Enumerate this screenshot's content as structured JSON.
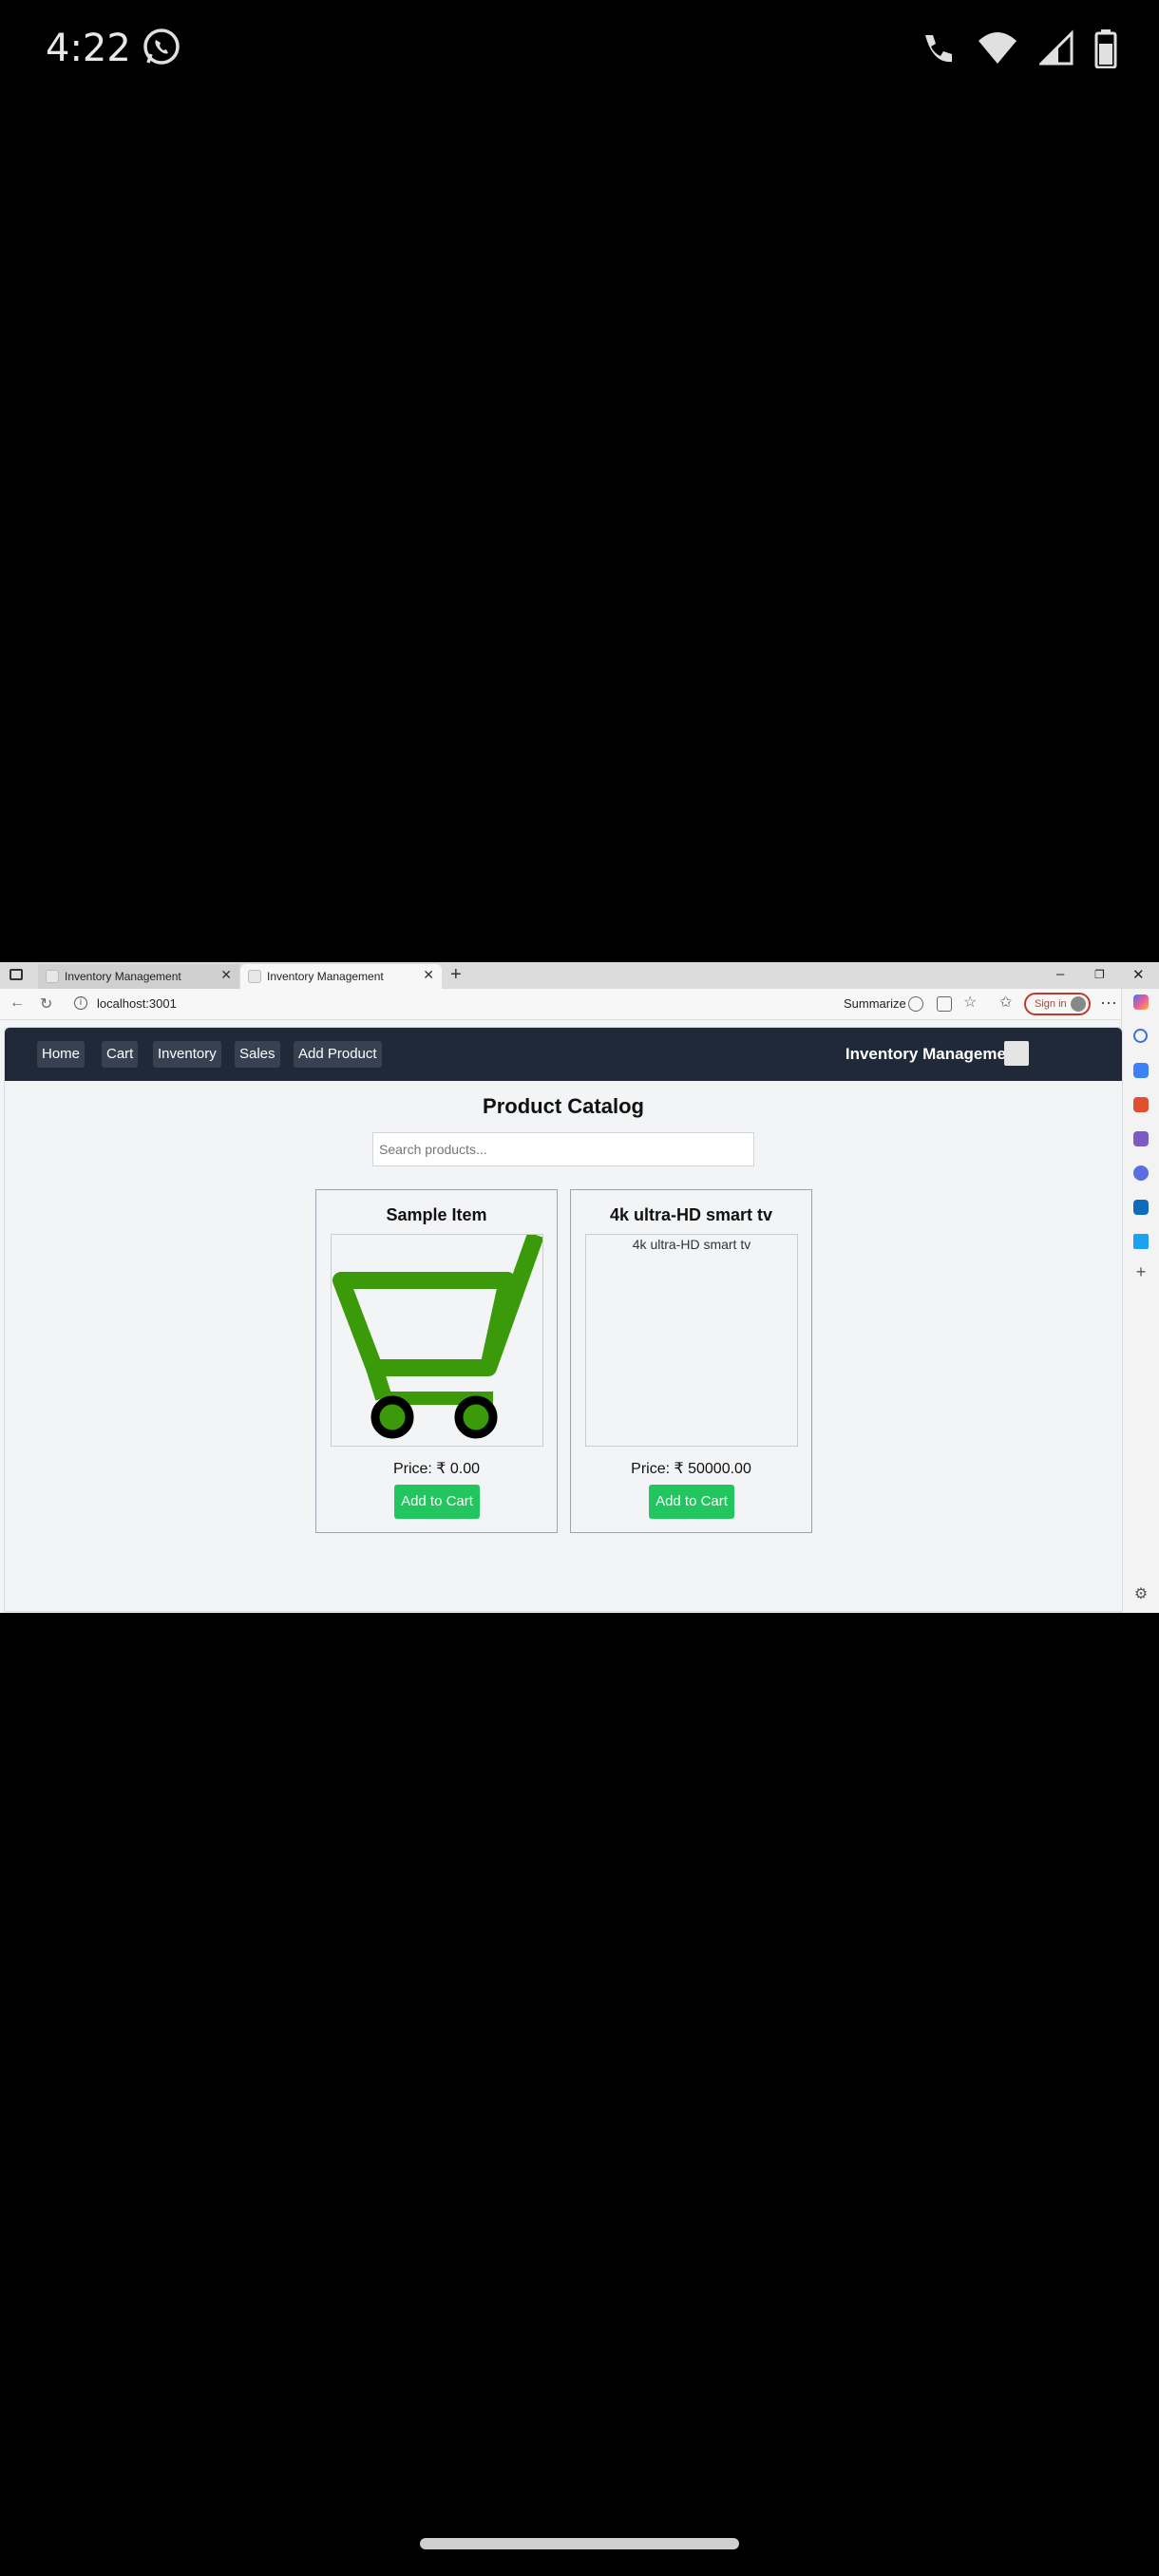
{
  "status_bar": {
    "time": "4:22"
  },
  "browser": {
    "tabs": [
      {
        "title": "Inventory Management"
      },
      {
        "title": "Inventory Management"
      }
    ],
    "url": "localhost:3001",
    "summarize_label": "Summarize",
    "signin_label": "Sign in"
  },
  "app": {
    "nav_items": [
      "Home",
      "Cart",
      "Inventory",
      "Sales",
      "Add Product"
    ],
    "brand": "Inventory Management",
    "page_title": "Product Catalog",
    "search_placeholder": "Search products...",
    "products": [
      {
        "name": "Sample Item",
        "price": "Price: ₹ 0.00",
        "image_alt": "",
        "button": "Add to Cart"
      },
      {
        "name": "4k ultra-HD smart tv",
        "price": "Price: ₹ 50000.00",
        "image_alt": "4k ultra-HD smart tv",
        "button": "Add to Cart"
      }
    ]
  },
  "colors": {
    "nav_bg": "#1f2937",
    "button_green": "#22c55e",
    "cart_green": "#3a9a0a"
  }
}
